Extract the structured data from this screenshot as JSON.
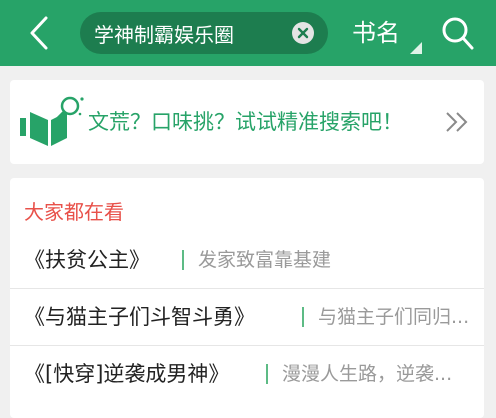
{
  "header": {
    "search_value": "学神制霸娱乐圈",
    "scope_label": "书名"
  },
  "promo": {
    "text": "文荒？口味挑？试试精准搜索吧！"
  },
  "hot": {
    "title": "大家都在看",
    "items": [
      {
        "name": "《扶贫公主》",
        "desc": "发家致富靠基建"
      },
      {
        "name": "《与猫主子们斗智斗勇》",
        "desc": "与猫主子们同归..."
      },
      {
        "name": "《[快穿]逆袭成男神》",
        "desc": "漫漫人生路，逆袭..."
      }
    ]
  },
  "colors": {
    "brand_green": "#27a368",
    "search_bg": "#1d7d4f",
    "hot_title_red": "#e8514a"
  }
}
